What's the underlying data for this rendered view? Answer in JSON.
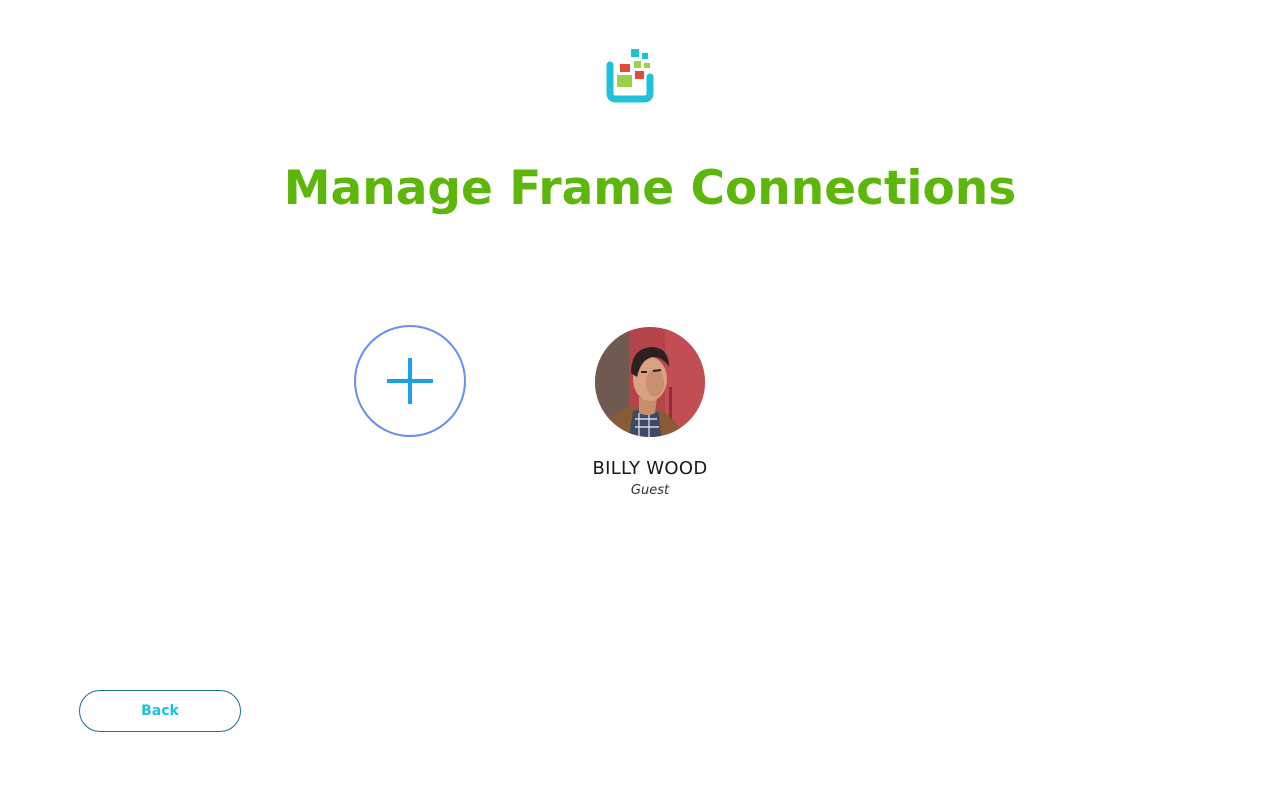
{
  "header": {
    "logo_icon": "frame-app-logo-icon",
    "title": "Manage Frame Connections"
  },
  "connections": {
    "add_icon": "plus-icon",
    "items": [
      {
        "name": "BILLY WOOD",
        "role": "Guest"
      }
    ]
  },
  "footer": {
    "back_label": "Back"
  },
  "colors": {
    "title": "#5db70a",
    "add_border": "#6b8cf0",
    "plus": "#1da1e6",
    "back_text": "#1ec1d9",
    "back_border": "#1f6f8b",
    "logo_frame": "#1ec1d9",
    "logo_green": "#9ccf4a",
    "logo_red": "#e8473c"
  }
}
